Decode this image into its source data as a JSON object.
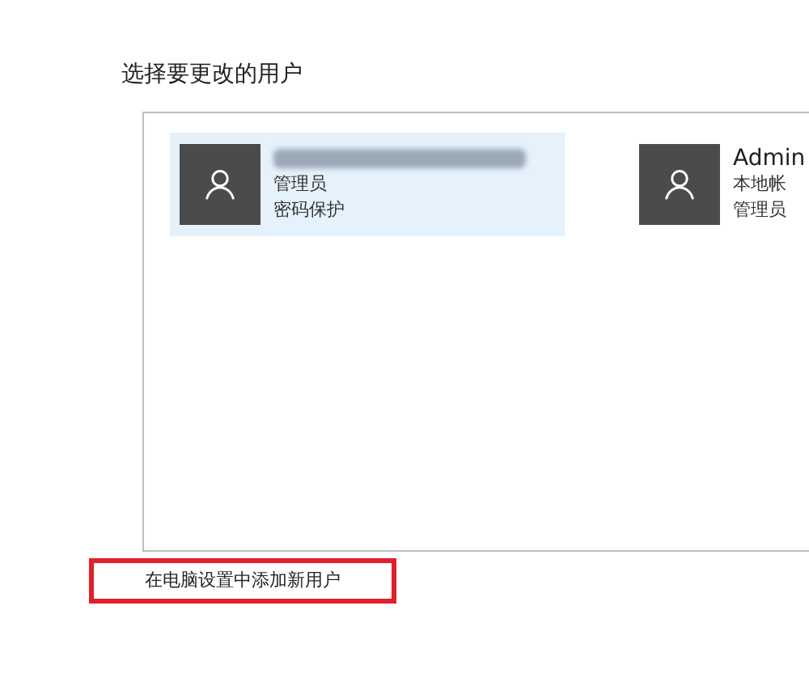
{
  "heading": "选择要更改的用户",
  "users": [
    {
      "name_blurred": true,
      "lines": [
        "管理员",
        "密码保护"
      ],
      "selected": true
    },
    {
      "name": "Admin",
      "lines": [
        "本地帐",
        "管理员"
      ],
      "selected": false
    }
  ],
  "add_link": {
    "label": "在电脑设置中添加新用户",
    "highlighted": true
  }
}
